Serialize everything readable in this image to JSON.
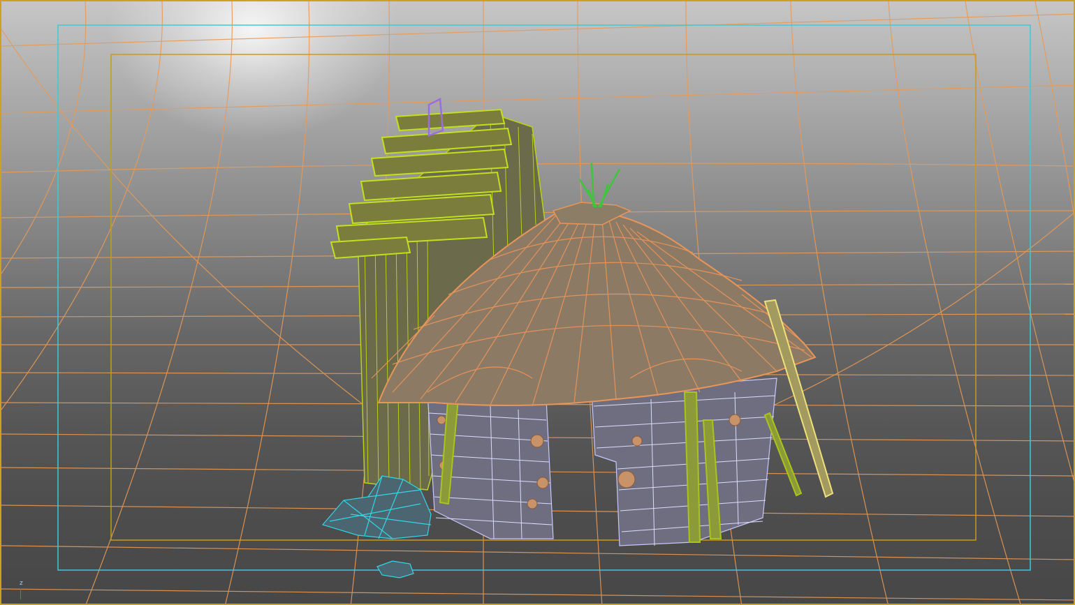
{
  "viewport": {
    "name": "3d-perspective-viewport",
    "axis_label": "z",
    "frame_colors": {
      "outer_border": "#c9a21f",
      "safe_frame_outer": "#3fc9d6",
      "safe_frame_inner": "#c99a1f",
      "grid": "#e89a55"
    }
  },
  "scene_objects": [
    {
      "name": "wooden-shack",
      "wire_color": "#b7d21a"
    },
    {
      "name": "chimney-cap",
      "wire_color": "#9a6ee0"
    },
    {
      "name": "thatched-roof",
      "wire_color": "#e8955a"
    },
    {
      "name": "grass-tuft",
      "wire_color": "#3ec63a"
    },
    {
      "name": "log-hut-walls",
      "wire_color": "#c8c8ff"
    },
    {
      "name": "support-poles",
      "wire_color": "#a9c41a"
    },
    {
      "name": "leaning-plank",
      "wire_color": "#f0e07a"
    },
    {
      "name": "rock-pile",
      "wire_color": "#33d6e6"
    },
    {
      "name": "small-rock",
      "wire_color": "#33d6e6"
    }
  ]
}
